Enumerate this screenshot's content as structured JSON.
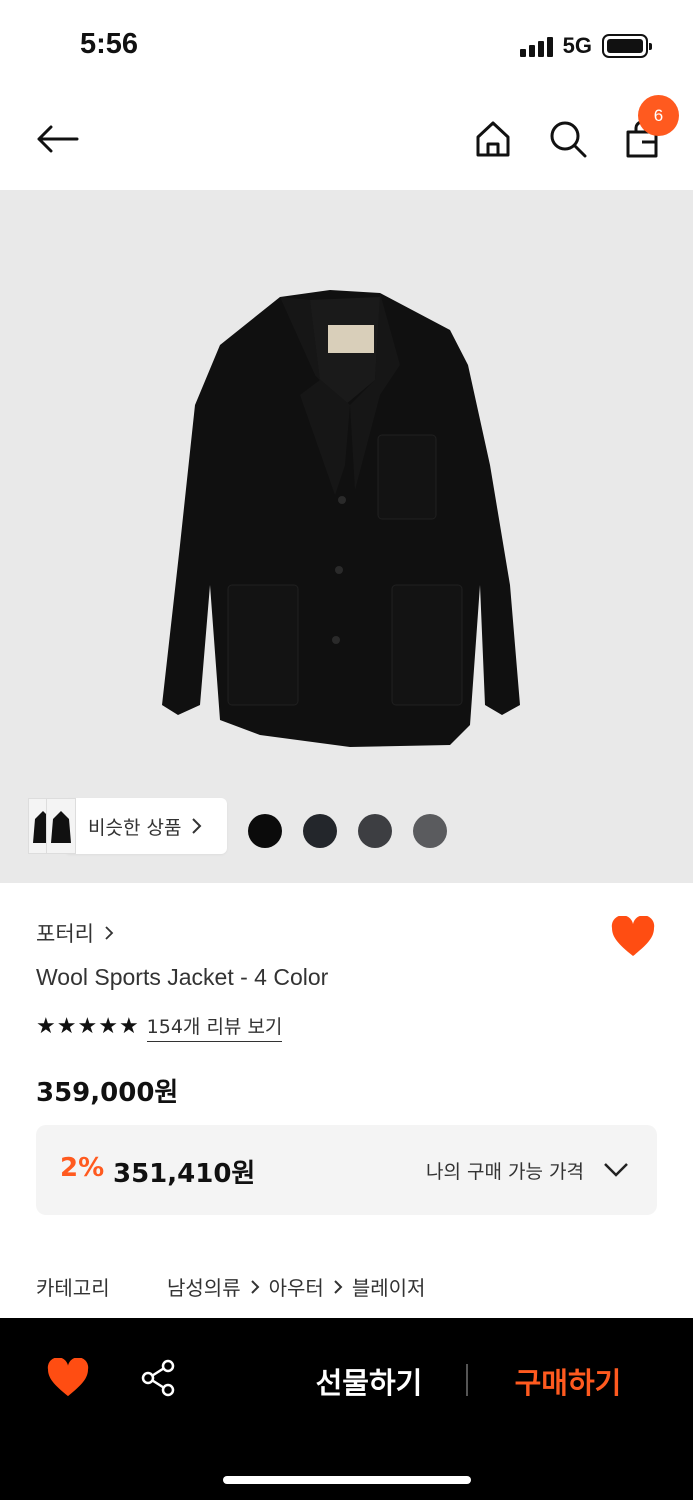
{
  "status_bar": {
    "time": "5:56",
    "network": "5G"
  },
  "header": {
    "cart_count": "6"
  },
  "hero": {
    "similar_label": "비슷한 상품",
    "swatch_colors": [
      "#0b0b0b",
      "#23262b",
      "#3d3e42",
      "#5a5b5e"
    ]
  },
  "product": {
    "brand": "포터리",
    "name": "Wool Sports Jacket - 4 Color",
    "rating_stars": 5,
    "review_link": "154개 리뷰 보기",
    "price": "359,000원",
    "discount_rate": "2%",
    "my_price": "351,410원",
    "my_price_label": "나의 구매 가능 가격"
  },
  "category": {
    "label": "카테고리",
    "path": [
      "남성의류",
      "아우터",
      "블레이저"
    ]
  },
  "bottom_bar": {
    "gift_label": "선물하기",
    "buy_label": "구매하기"
  },
  "colors": {
    "accent": "#ff5a1f",
    "bottom_bar": "#000000",
    "hero_bg": "#e9e9e9"
  }
}
